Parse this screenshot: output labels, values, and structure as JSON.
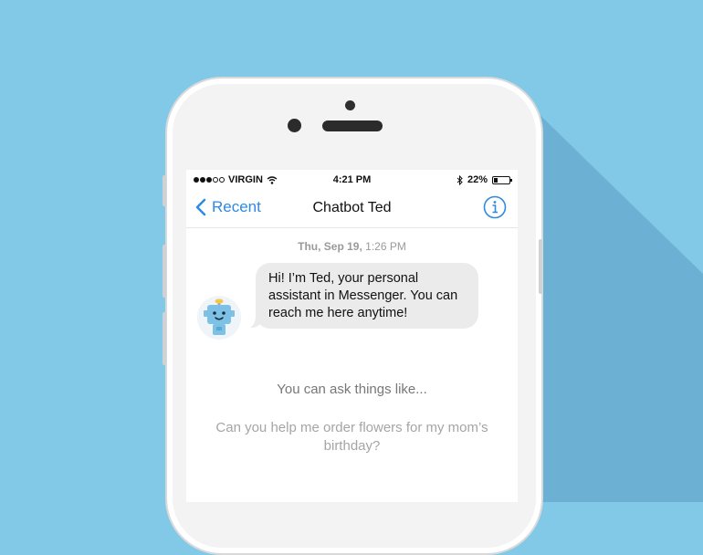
{
  "status_bar": {
    "carrier": "VIRGIN",
    "time": "4:21 PM",
    "battery_percent": "22%",
    "battery_level": 0.22,
    "signal_bars_filled": 3,
    "signal_bars_total": 5,
    "icons": [
      "wifi-icon",
      "bluetooth-icon",
      "battery-icon"
    ]
  },
  "nav": {
    "back_label": "Recent",
    "title": "Chatbot Ted",
    "info_icon": "info-icon"
  },
  "conversation": {
    "timestamp_date": "Thu, Sep 19,",
    "timestamp_time": "1:26 PM",
    "message": "Hi! I’m Ted, your personal assistant in Messenger. You can reach me here anytime!",
    "avatar_icon": "robot-avatar-icon"
  },
  "hints": {
    "title": "You can ask things like...",
    "example": "Can you help me order flowers for my mom’s birthday?"
  },
  "colors": {
    "background": "#82c9e8",
    "shadow": "#6cb1d3",
    "accent": "#2d8ae0",
    "bubble": "#ebebeb"
  }
}
